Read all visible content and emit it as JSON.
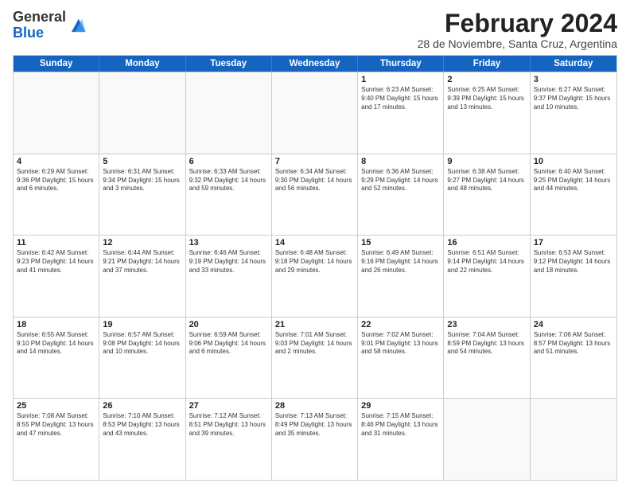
{
  "header": {
    "logo_general": "General",
    "logo_blue": "Blue",
    "month_title": "February 2024",
    "subtitle": "28 de Noviembre, Santa Cruz, Argentina"
  },
  "calendar": {
    "days_of_week": [
      "Sunday",
      "Monday",
      "Tuesday",
      "Wednesday",
      "Thursday",
      "Friday",
      "Saturday"
    ],
    "weeks": [
      [
        {
          "day": "",
          "info": "",
          "empty": true
        },
        {
          "day": "",
          "info": "",
          "empty": true
        },
        {
          "day": "",
          "info": "",
          "empty": true
        },
        {
          "day": "",
          "info": "",
          "empty": true
        },
        {
          "day": "1",
          "info": "Sunrise: 6:23 AM\nSunset: 9:40 PM\nDaylight: 15 hours\nand 17 minutes."
        },
        {
          "day": "2",
          "info": "Sunrise: 6:25 AM\nSunset: 9:39 PM\nDaylight: 15 hours\nand 13 minutes."
        },
        {
          "day": "3",
          "info": "Sunrise: 6:27 AM\nSunset: 9:37 PM\nDaylight: 15 hours\nand 10 minutes."
        }
      ],
      [
        {
          "day": "4",
          "info": "Sunrise: 6:29 AM\nSunset: 9:36 PM\nDaylight: 15 hours\nand 6 minutes."
        },
        {
          "day": "5",
          "info": "Sunrise: 6:31 AM\nSunset: 9:34 PM\nDaylight: 15 hours\nand 3 minutes."
        },
        {
          "day": "6",
          "info": "Sunrise: 6:33 AM\nSunset: 9:32 PM\nDaylight: 14 hours\nand 59 minutes."
        },
        {
          "day": "7",
          "info": "Sunrise: 6:34 AM\nSunset: 9:30 PM\nDaylight: 14 hours\nand 56 minutes."
        },
        {
          "day": "8",
          "info": "Sunrise: 6:36 AM\nSunset: 9:29 PM\nDaylight: 14 hours\nand 52 minutes."
        },
        {
          "day": "9",
          "info": "Sunrise: 6:38 AM\nSunset: 9:27 PM\nDaylight: 14 hours\nand 48 minutes."
        },
        {
          "day": "10",
          "info": "Sunrise: 6:40 AM\nSunset: 9:25 PM\nDaylight: 14 hours\nand 44 minutes."
        }
      ],
      [
        {
          "day": "11",
          "info": "Sunrise: 6:42 AM\nSunset: 9:23 PM\nDaylight: 14 hours\nand 41 minutes."
        },
        {
          "day": "12",
          "info": "Sunrise: 6:44 AM\nSunset: 9:21 PM\nDaylight: 14 hours\nand 37 minutes."
        },
        {
          "day": "13",
          "info": "Sunrise: 6:46 AM\nSunset: 9:19 PM\nDaylight: 14 hours\nand 33 minutes."
        },
        {
          "day": "14",
          "info": "Sunrise: 6:48 AM\nSunset: 9:18 PM\nDaylight: 14 hours\nand 29 minutes."
        },
        {
          "day": "15",
          "info": "Sunrise: 6:49 AM\nSunset: 9:16 PM\nDaylight: 14 hours\nand 26 minutes."
        },
        {
          "day": "16",
          "info": "Sunrise: 6:51 AM\nSunset: 9:14 PM\nDaylight: 14 hours\nand 22 minutes."
        },
        {
          "day": "17",
          "info": "Sunrise: 6:53 AM\nSunset: 9:12 PM\nDaylight: 14 hours\nand 18 minutes."
        }
      ],
      [
        {
          "day": "18",
          "info": "Sunrise: 6:55 AM\nSunset: 9:10 PM\nDaylight: 14 hours\nand 14 minutes."
        },
        {
          "day": "19",
          "info": "Sunrise: 6:57 AM\nSunset: 9:08 PM\nDaylight: 14 hours\nand 10 minutes."
        },
        {
          "day": "20",
          "info": "Sunrise: 6:59 AM\nSunset: 9:06 PM\nDaylight: 14 hours\nand 6 minutes."
        },
        {
          "day": "21",
          "info": "Sunrise: 7:01 AM\nSunset: 9:03 PM\nDaylight: 14 hours\nand 2 minutes."
        },
        {
          "day": "22",
          "info": "Sunrise: 7:02 AM\nSunset: 9:01 PM\nDaylight: 13 hours\nand 58 minutes."
        },
        {
          "day": "23",
          "info": "Sunrise: 7:04 AM\nSunset: 8:59 PM\nDaylight: 13 hours\nand 54 minutes."
        },
        {
          "day": "24",
          "info": "Sunrise: 7:06 AM\nSunset: 8:57 PM\nDaylight: 13 hours\nand 51 minutes."
        }
      ],
      [
        {
          "day": "25",
          "info": "Sunrise: 7:08 AM\nSunset: 8:55 PM\nDaylight: 13 hours\nand 47 minutes."
        },
        {
          "day": "26",
          "info": "Sunrise: 7:10 AM\nSunset: 8:53 PM\nDaylight: 13 hours\nand 43 minutes."
        },
        {
          "day": "27",
          "info": "Sunrise: 7:12 AM\nSunset: 8:51 PM\nDaylight: 13 hours\nand 39 minutes."
        },
        {
          "day": "28",
          "info": "Sunrise: 7:13 AM\nSunset: 8:49 PM\nDaylight: 13 hours\nand 35 minutes."
        },
        {
          "day": "29",
          "info": "Sunrise: 7:15 AM\nSunset: 8:46 PM\nDaylight: 13 hours\nand 31 minutes."
        },
        {
          "day": "",
          "info": "",
          "empty": true
        },
        {
          "day": "",
          "info": "",
          "empty": true
        }
      ]
    ]
  }
}
